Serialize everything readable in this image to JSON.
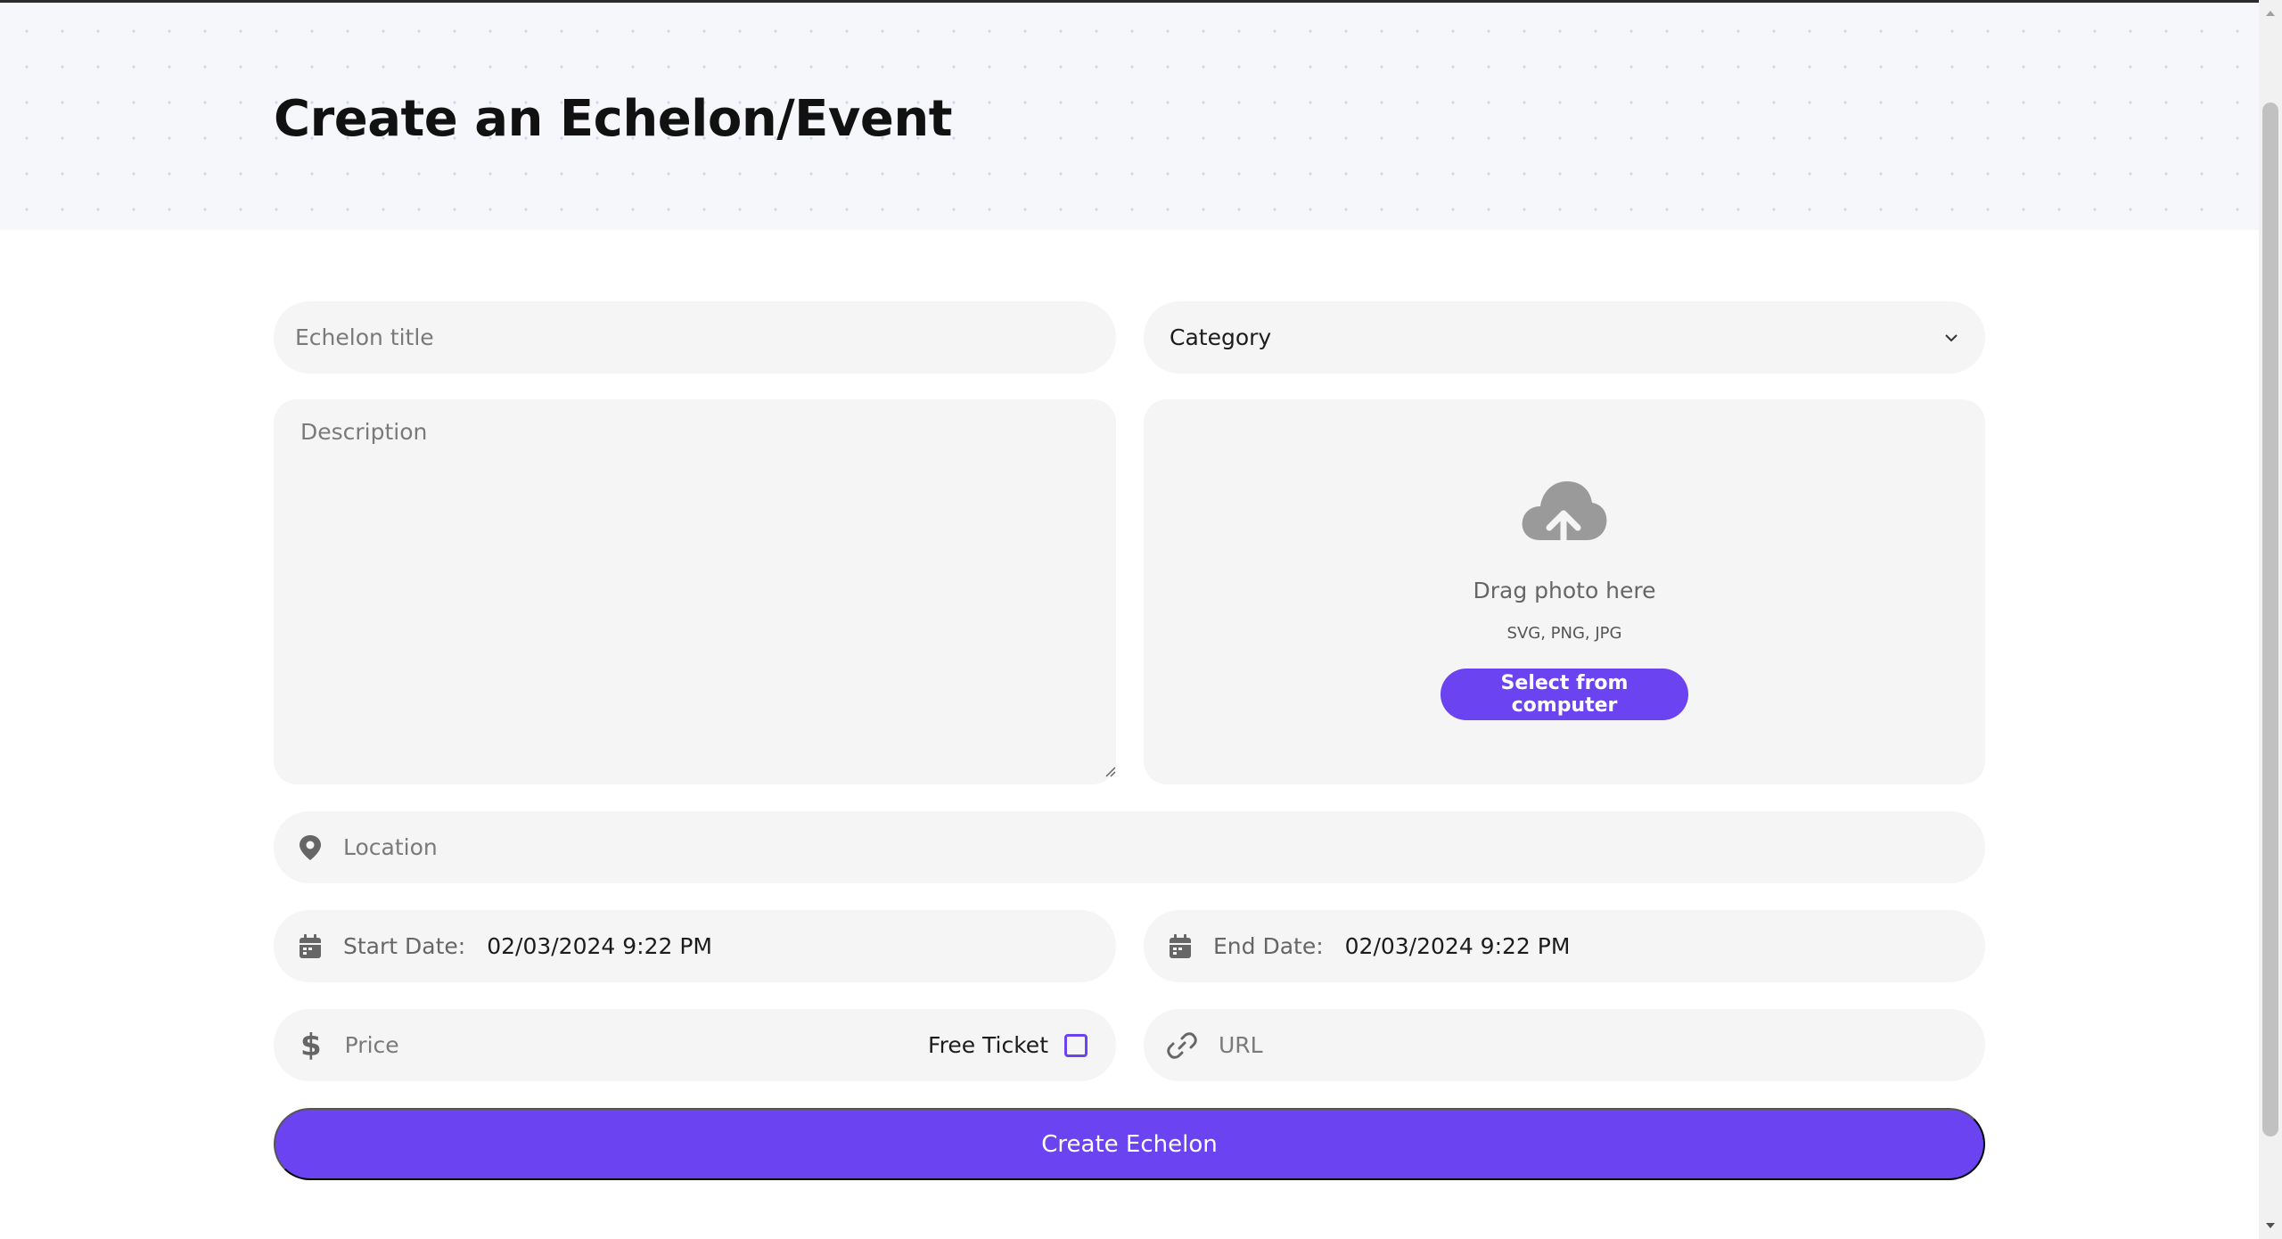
{
  "page": {
    "title": "Create an Echelon/Event"
  },
  "form": {
    "title_placeholder": "Echelon title",
    "category_label": "Category",
    "description_placeholder": "Description",
    "upload": {
      "drag_text": "Drag photo here",
      "formats": "SVG, PNG, JPG",
      "button_label": "Select from computer"
    },
    "location_placeholder": "Location",
    "start_date": {
      "label": "Start Date:",
      "value": "02/03/2024 9:22 PM"
    },
    "end_date": {
      "label": "End Date:",
      "value": "02/03/2024 9:22 PM"
    },
    "price_placeholder": "Price",
    "free_ticket_label": "Free Ticket",
    "url_placeholder": "URL",
    "submit_label": "Create Echelon"
  },
  "colors": {
    "accent": "#6c43f0",
    "field_bg": "#f5f5f5",
    "hero_bg": "#f6f7fb"
  },
  "icons": {
    "location": "map-pin-icon",
    "calendar": "calendar-icon",
    "price": "dollar-icon",
    "url": "link-icon",
    "upload": "cloud-upload-icon",
    "dropdown": "chevron-down-icon"
  }
}
